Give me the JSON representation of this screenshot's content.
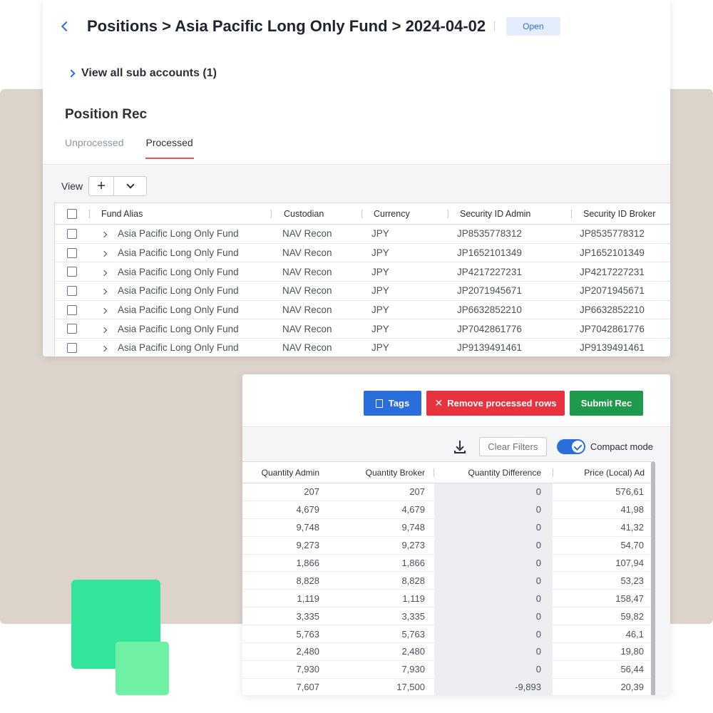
{
  "colors": {
    "accent": "#2a6edc",
    "danger": "#e8323f",
    "success": "#1f9a4c",
    "active_tab_underline": "#e35a45",
    "backdrop": "#dcd4cb",
    "decor_green": "#33e49b",
    "decor_green_light": "#6ef0a5"
  },
  "header": {
    "breadcrumb": "Positions > Asia Pacific Long Only Fund > 2024-04-02",
    "status_badge": "Open",
    "back_icon": "chevron-left-icon"
  },
  "sub_accounts": {
    "label": "View all sub accounts (1)",
    "icon": "chevron-right-icon"
  },
  "section": {
    "title": "Position Rec",
    "tabs": [
      {
        "label": "Unprocessed",
        "active": false
      },
      {
        "label": "Processed",
        "active": true
      }
    ]
  },
  "view_toolbar": {
    "label": "View",
    "add_icon": "plus-icon",
    "add_symbol": "+",
    "menu_icon": "chevron-down-icon"
  },
  "positions_table": {
    "columns": [
      "Fund Alias",
      "Custodian",
      "Currency",
      "Security ID Admin",
      "Security ID Broker"
    ],
    "rows": [
      {
        "alias": "Asia Pacific Long Only Fund",
        "custodian": "NAV Recon",
        "currency": "JPY",
        "sec_admin": "JP8535778312",
        "sec_broker": "JP8535778312"
      },
      {
        "alias": "Asia Pacific Long Only Fund",
        "custodian": "NAV Recon",
        "currency": "JPY",
        "sec_admin": "JP1652101349",
        "sec_broker": "JP1652101349"
      },
      {
        "alias": "Asia Pacific Long Only Fund",
        "custodian": "NAV Recon",
        "currency": "JPY",
        "sec_admin": "JP4217227231",
        "sec_broker": "JP4217227231"
      },
      {
        "alias": "Asia Pacific Long Only Fund",
        "custodian": "NAV Recon",
        "currency": "JPY",
        "sec_admin": "JP2071945671",
        "sec_broker": "JP2071945671"
      },
      {
        "alias": "Asia Pacific Long Only Fund",
        "custodian": "NAV Recon",
        "currency": "JPY",
        "sec_admin": "JP6632852210",
        "sec_broker": "JP6632852210"
      },
      {
        "alias": "Asia Pacific Long Only Fund",
        "custodian": "NAV Recon",
        "currency": "JPY",
        "sec_admin": "JP7042861776",
        "sec_broker": "JP7042861776"
      },
      {
        "alias": "Asia Pacific Long Only Fund",
        "custodian": "NAV Recon",
        "currency": "JPY",
        "sec_admin": "JP9139491461",
        "sec_broker": "JP9139491461"
      }
    ]
  },
  "actions": {
    "tags": "Tags",
    "tags_icon": "document-icon",
    "remove": "Remove processed rows",
    "remove_icon": "close-icon",
    "remove_symbol": "✕",
    "submit": "Submit Rec"
  },
  "grid_toolbar": {
    "download_icon": "download-icon",
    "clear_filters": "Clear Filters",
    "compact_mode": "Compact mode",
    "compact_enabled": true
  },
  "quantity_table": {
    "columns": [
      "Quantity Admin",
      "Quantity Broker",
      "Quantity Difference",
      "Price (Local) Ad"
    ],
    "rows": [
      {
        "q_admin": "207",
        "q_broker": "207",
        "q_diff": "0",
        "price": "576,61"
      },
      {
        "q_admin": "4,679",
        "q_broker": "4,679",
        "q_diff": "0",
        "price": "41,98"
      },
      {
        "q_admin": "9,748",
        "q_broker": "9,748",
        "q_diff": "0",
        "price": "41,32"
      },
      {
        "q_admin": "9,273",
        "q_broker": "9,273",
        "q_diff": "0",
        "price": "54,70"
      },
      {
        "q_admin": "1,866",
        "q_broker": "1,866",
        "q_diff": "0",
        "price": "107,94"
      },
      {
        "q_admin": "8,828",
        "q_broker": "8,828",
        "q_diff": "0",
        "price": "53,23"
      },
      {
        "q_admin": "1,119",
        "q_broker": "1,119",
        "q_diff": "0",
        "price": "158,47"
      },
      {
        "q_admin": "3,335",
        "q_broker": "3,335",
        "q_diff": "0",
        "price": "59,82"
      },
      {
        "q_admin": "5,763",
        "q_broker": "5,763",
        "q_diff": "0",
        "price": "46,1"
      },
      {
        "q_admin": "2,480",
        "q_broker": "2,480",
        "q_diff": "0",
        "price": "19,80"
      },
      {
        "q_admin": "7,930",
        "q_broker": "7,930",
        "q_diff": "0",
        "price": "56,44"
      },
      {
        "q_admin": "7,607",
        "q_broker": "17,500",
        "q_diff": "-9,893",
        "price": "20,39"
      }
    ]
  }
}
